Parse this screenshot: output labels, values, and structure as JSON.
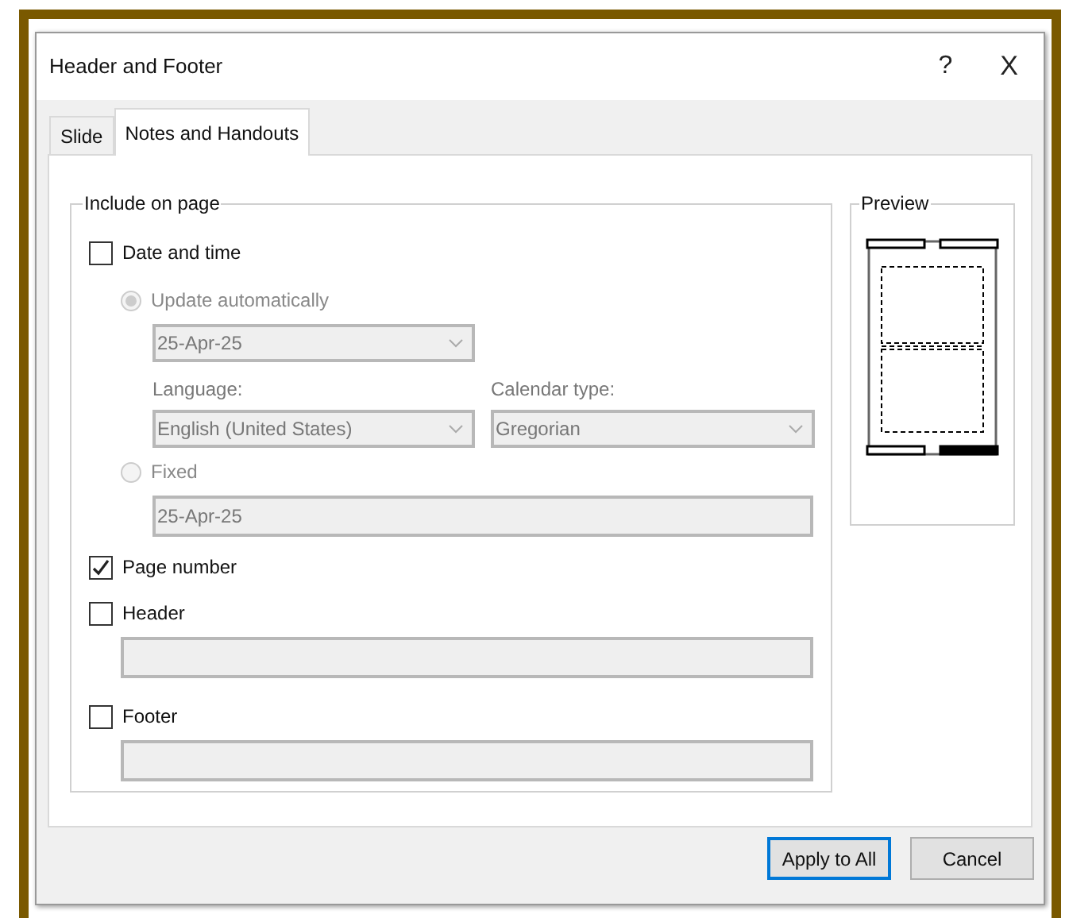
{
  "window": {
    "title": "Header and Footer",
    "help": "?",
    "close": "X"
  },
  "tabs": [
    {
      "label": "Slide",
      "selected": false
    },
    {
      "label": "Notes and Handouts",
      "selected": true
    }
  ],
  "include_group": {
    "title": "Include on page",
    "date_time": {
      "label": "Date and time",
      "checked": false
    },
    "update_auto": {
      "label": "Update automatically",
      "selected": true,
      "disabled": true
    },
    "date_select": {
      "value": "25-Apr-25",
      "disabled": true
    },
    "language": {
      "label": "Language:",
      "value": "English (United States)",
      "disabled": true
    },
    "calendar": {
      "label": "Calendar type:",
      "value": "Gregorian",
      "disabled": true
    },
    "fixed": {
      "label": "Fixed",
      "selected": false,
      "disabled": true
    },
    "fixed_field": {
      "value": "25-Apr-25",
      "disabled": true
    },
    "page_number": {
      "label": "Page number",
      "checked": true
    },
    "header": {
      "label": "Header",
      "checked": false
    },
    "header_field": {
      "disabled": true
    },
    "footer": {
      "label": "Footer",
      "checked": false
    },
    "footer_field": {
      "disabled": true
    }
  },
  "preview": {
    "title": "Preview"
  },
  "buttons": [
    {
      "label": "Apply to All",
      "default": true
    },
    {
      "label": "Cancel",
      "default": false
    }
  ]
}
